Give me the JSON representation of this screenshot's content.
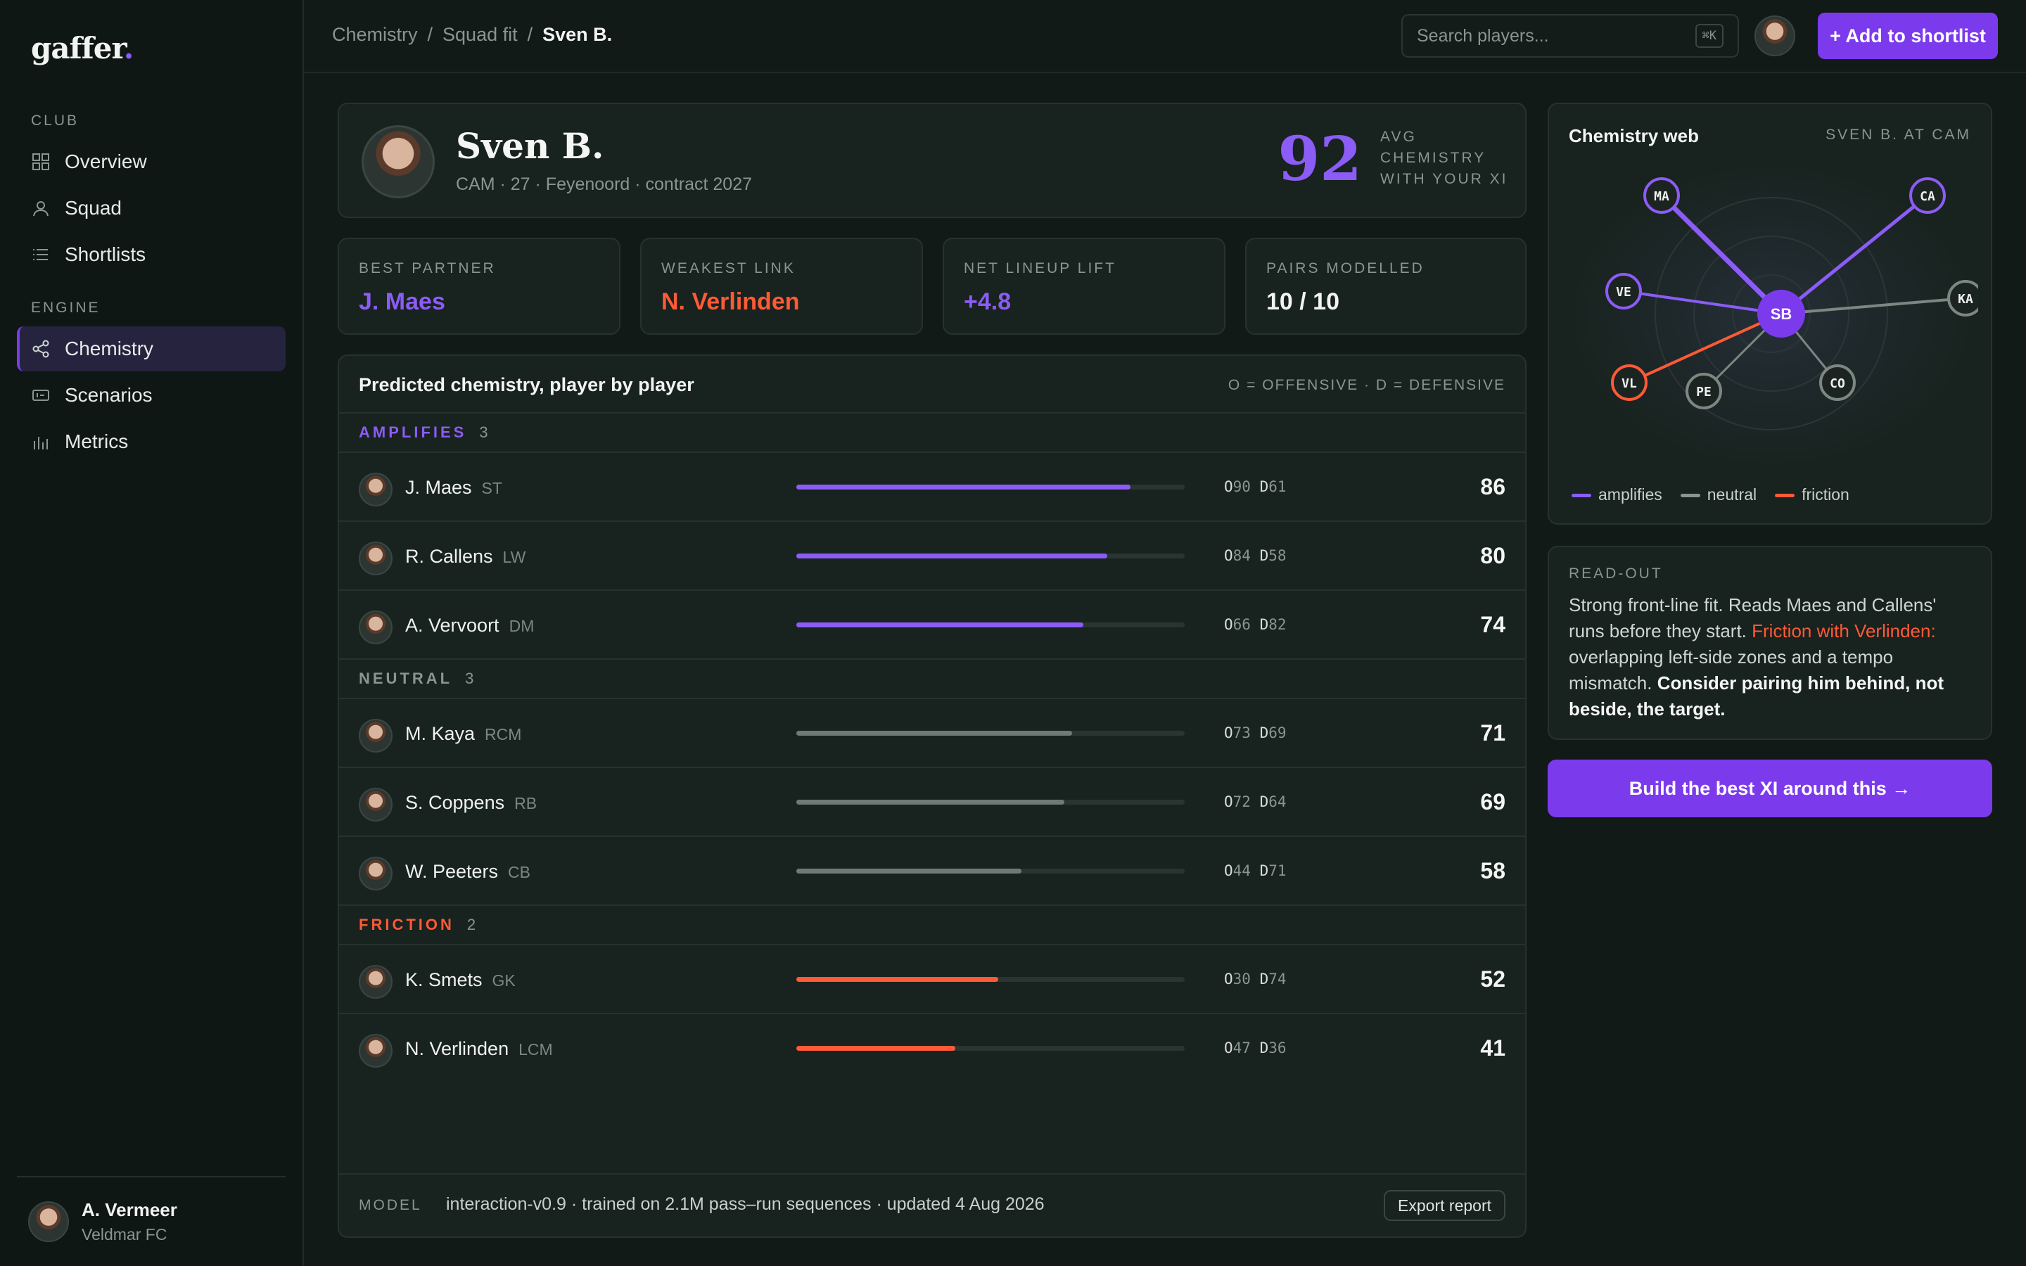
{
  "sidebar": {
    "logo": "gaffer",
    "logo_dot": ".",
    "club_label": "CLUB",
    "engine_label": "ENGINE",
    "items": [
      {
        "label": "Overview",
        "icon": "grid-icon"
      },
      {
        "label": "Squad",
        "icon": "user-icon"
      },
      {
        "label": "Shortlists",
        "icon": "list-icon"
      },
      {
        "label": "Chemistry",
        "icon": "share-nodes-icon",
        "active": true
      },
      {
        "label": "Scenarios",
        "icon": "ticket-icon"
      },
      {
        "label": "Metrics",
        "icon": "bar-chart-icon"
      }
    ],
    "user": {
      "name": "A. Vermeer",
      "club": "Veldmar FC"
    }
  },
  "topbar": {
    "breadcrumbs": [
      "Chemistry",
      "Squad fit",
      "Sven B."
    ],
    "separator": "/",
    "search_placeholder": "Search players...",
    "search_shortcut": "⌘K",
    "add_button": "+ Add to shortlist"
  },
  "hero": {
    "name": "Sven B.",
    "meta": "CAM · 27 · Feyenoord · contract 2027",
    "score": "92",
    "score_label": "AVG CHEMISTRY WITH YOUR XI"
  },
  "stats": [
    {
      "label": "BEST PARTNER",
      "value": "J. Maes",
      "color": "#8b5cf6"
    },
    {
      "label": "WEAKEST LINK",
      "value": "N. Verlinden",
      "color": "#ff5a36"
    },
    {
      "label": "NET LINEUP LIFT",
      "value": "+4.8",
      "color": "#8b5cf6"
    },
    {
      "label": "PAIRS MODELLED",
      "value": "10 / 10",
      "color": "#f2f4f2"
    }
  ],
  "table": {
    "title": "Predicted chemistry, player by player",
    "legend": "O = OFFENSIVE · D = DEFENSIVE",
    "groups": [
      {
        "label": "AMPLIFIES",
        "count": "3",
        "color": "#8b5cf6",
        "rows": [
          {
            "name": "J. Maes",
            "pos": "ST",
            "o": "90",
            "d": "61",
            "score": 86
          },
          {
            "name": "R. Callens",
            "pos": "LW",
            "o": "84",
            "d": "58",
            "score": 80
          },
          {
            "name": "A. Vervoort",
            "pos": "DM",
            "o": "66",
            "d": "82",
            "score": 74
          }
        ]
      },
      {
        "label": "NEUTRAL",
        "count": "3",
        "color": "#8a958f",
        "rows": [
          {
            "name": "M. Kaya",
            "pos": "RCM",
            "o": "73",
            "d": "69",
            "score": 71
          },
          {
            "name": "S. Coppens",
            "pos": "RB",
            "o": "72",
            "d": "64",
            "score": 69
          },
          {
            "name": "W. Peeters",
            "pos": "CB",
            "o": "44",
            "d": "71",
            "score": 58
          }
        ]
      },
      {
        "label": "FRICTION",
        "count": "2",
        "color": "#ff5a36",
        "rows": [
          {
            "name": "K. Smets",
            "pos": "GK",
            "o": "30",
            "d": "74",
            "score": 52
          },
          {
            "name": "N. Verlinden",
            "pos": "LCM",
            "o": "47",
            "d": "36",
            "score": 41
          }
        ]
      }
    ],
    "bar_colors": {
      "amplifies": "#8b5cf6",
      "neutral": "#6f7a75",
      "friction": "#ff5a36"
    },
    "model_label": "MODEL",
    "model_value": "interaction-v0.9 · trained on 2.1M pass–run sequences · updated 4 Aug 2026",
    "export_button": "Export report"
  },
  "web": {
    "title": "Chemistry web",
    "subtitle": "SVEN B. AT CAM",
    "center": "SB",
    "nodes": [
      {
        "id": "MA",
        "type": "amplifies"
      },
      {
        "id": "CA",
        "type": "amplifies"
      },
      {
        "id": "VE",
        "type": "amplifies"
      },
      {
        "id": "KA",
        "type": "neutral"
      },
      {
        "id": "VL",
        "type": "friction"
      },
      {
        "id": "PE",
        "type": "neutral"
      },
      {
        "id": "CO",
        "type": "neutral"
      }
    ],
    "legend": [
      "amplifies",
      "neutral",
      "friction"
    ]
  },
  "readout": {
    "label": "READ-OUT",
    "text1": "Strong front-line fit. Reads Maes and Callens' runs before they start. ",
    "friction": "Friction with Verlinden:",
    "text2": " overlapping left-side zones and a tempo mismatch. ",
    "emphasis": "Consider pairing him behind, not beside, the target."
  },
  "cta": "Build the best XI around this →"
}
